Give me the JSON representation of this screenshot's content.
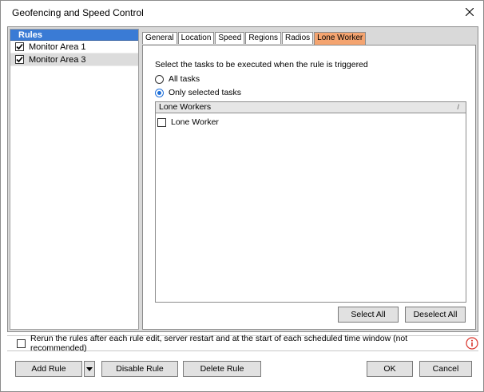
{
  "window": {
    "title": "Geofencing and Speed Control",
    "close_icon": "close-icon"
  },
  "rules": {
    "header": "Rules",
    "items": [
      {
        "label": "Monitor Area 1",
        "checked": true,
        "selected": false
      },
      {
        "label": "Monitor Area 3",
        "checked": true,
        "selected": true
      }
    ]
  },
  "tabs": [
    {
      "label": "General",
      "active": false
    },
    {
      "label": "Location",
      "active": false
    },
    {
      "label": "Speed",
      "active": false
    },
    {
      "label": "Regions",
      "active": false
    },
    {
      "label": "Radios",
      "active": false
    },
    {
      "label": "Lone Worker",
      "active": true
    }
  ],
  "lone_worker": {
    "instruction": "Select the tasks to be executed when the rule is triggered",
    "radio_all": "All tasks",
    "radio_selected": "Only selected tasks",
    "selected_option": "Only selected tasks",
    "list_header": "Lone Workers",
    "list_sort_marker": "/",
    "list_items": [
      {
        "label": "Lone Worker",
        "checked": false
      }
    ],
    "select_all": "Select All",
    "deselect_all": "Deselect All"
  },
  "footer": {
    "rerun_label": "Rerun the rules after each rule edit, server restart and at the start of each scheduled time window (not recommended)",
    "rerun_checked": false,
    "add_rule": "Add Rule",
    "disable_rule": "Disable Rule",
    "delete_rule": "Delete Rule",
    "ok": "OK",
    "cancel": "Cancel"
  },
  "colors": {
    "rules_header": "#3a7bd5",
    "active_tab": "#f4a470",
    "info_icon": "#d9342b",
    "radio_accent": "#1e6fd9"
  }
}
